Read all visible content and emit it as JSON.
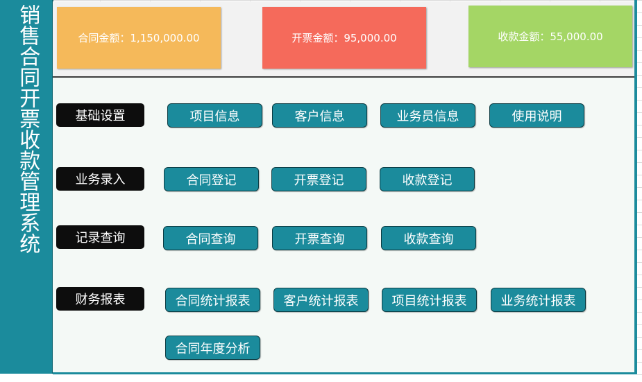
{
  "sidebar": {
    "title": "销售合同开票收款管理系统"
  },
  "summary": {
    "contract": "合同金额：1,150,000.00",
    "invoice": "开票金额：95,000.00",
    "receipt": "收款金额：55,000.00"
  },
  "sections": {
    "basic": {
      "label": "基础设置",
      "buttons": [
        "项目信息",
        "客户信息",
        "业务员信息",
        "使用说明"
      ]
    },
    "entry": {
      "label": "业务录入",
      "buttons": [
        "合同登记",
        "开票登记",
        "收款登记"
      ]
    },
    "query": {
      "label": "记录查询",
      "buttons": [
        "合同查询",
        "开票查询",
        "收款查询"
      ]
    },
    "report": {
      "label": "财务报表",
      "buttons": [
        "合同统计报表",
        "客户统计报表",
        "项目统计报表",
        "业务统计报表",
        "合同年度分析"
      ]
    }
  },
  "colors": {
    "teal": "#1b8b9c",
    "contract_card": "#f5b95a",
    "invoice_card": "#f56a5b",
    "receipt_card": "#a4d665"
  }
}
